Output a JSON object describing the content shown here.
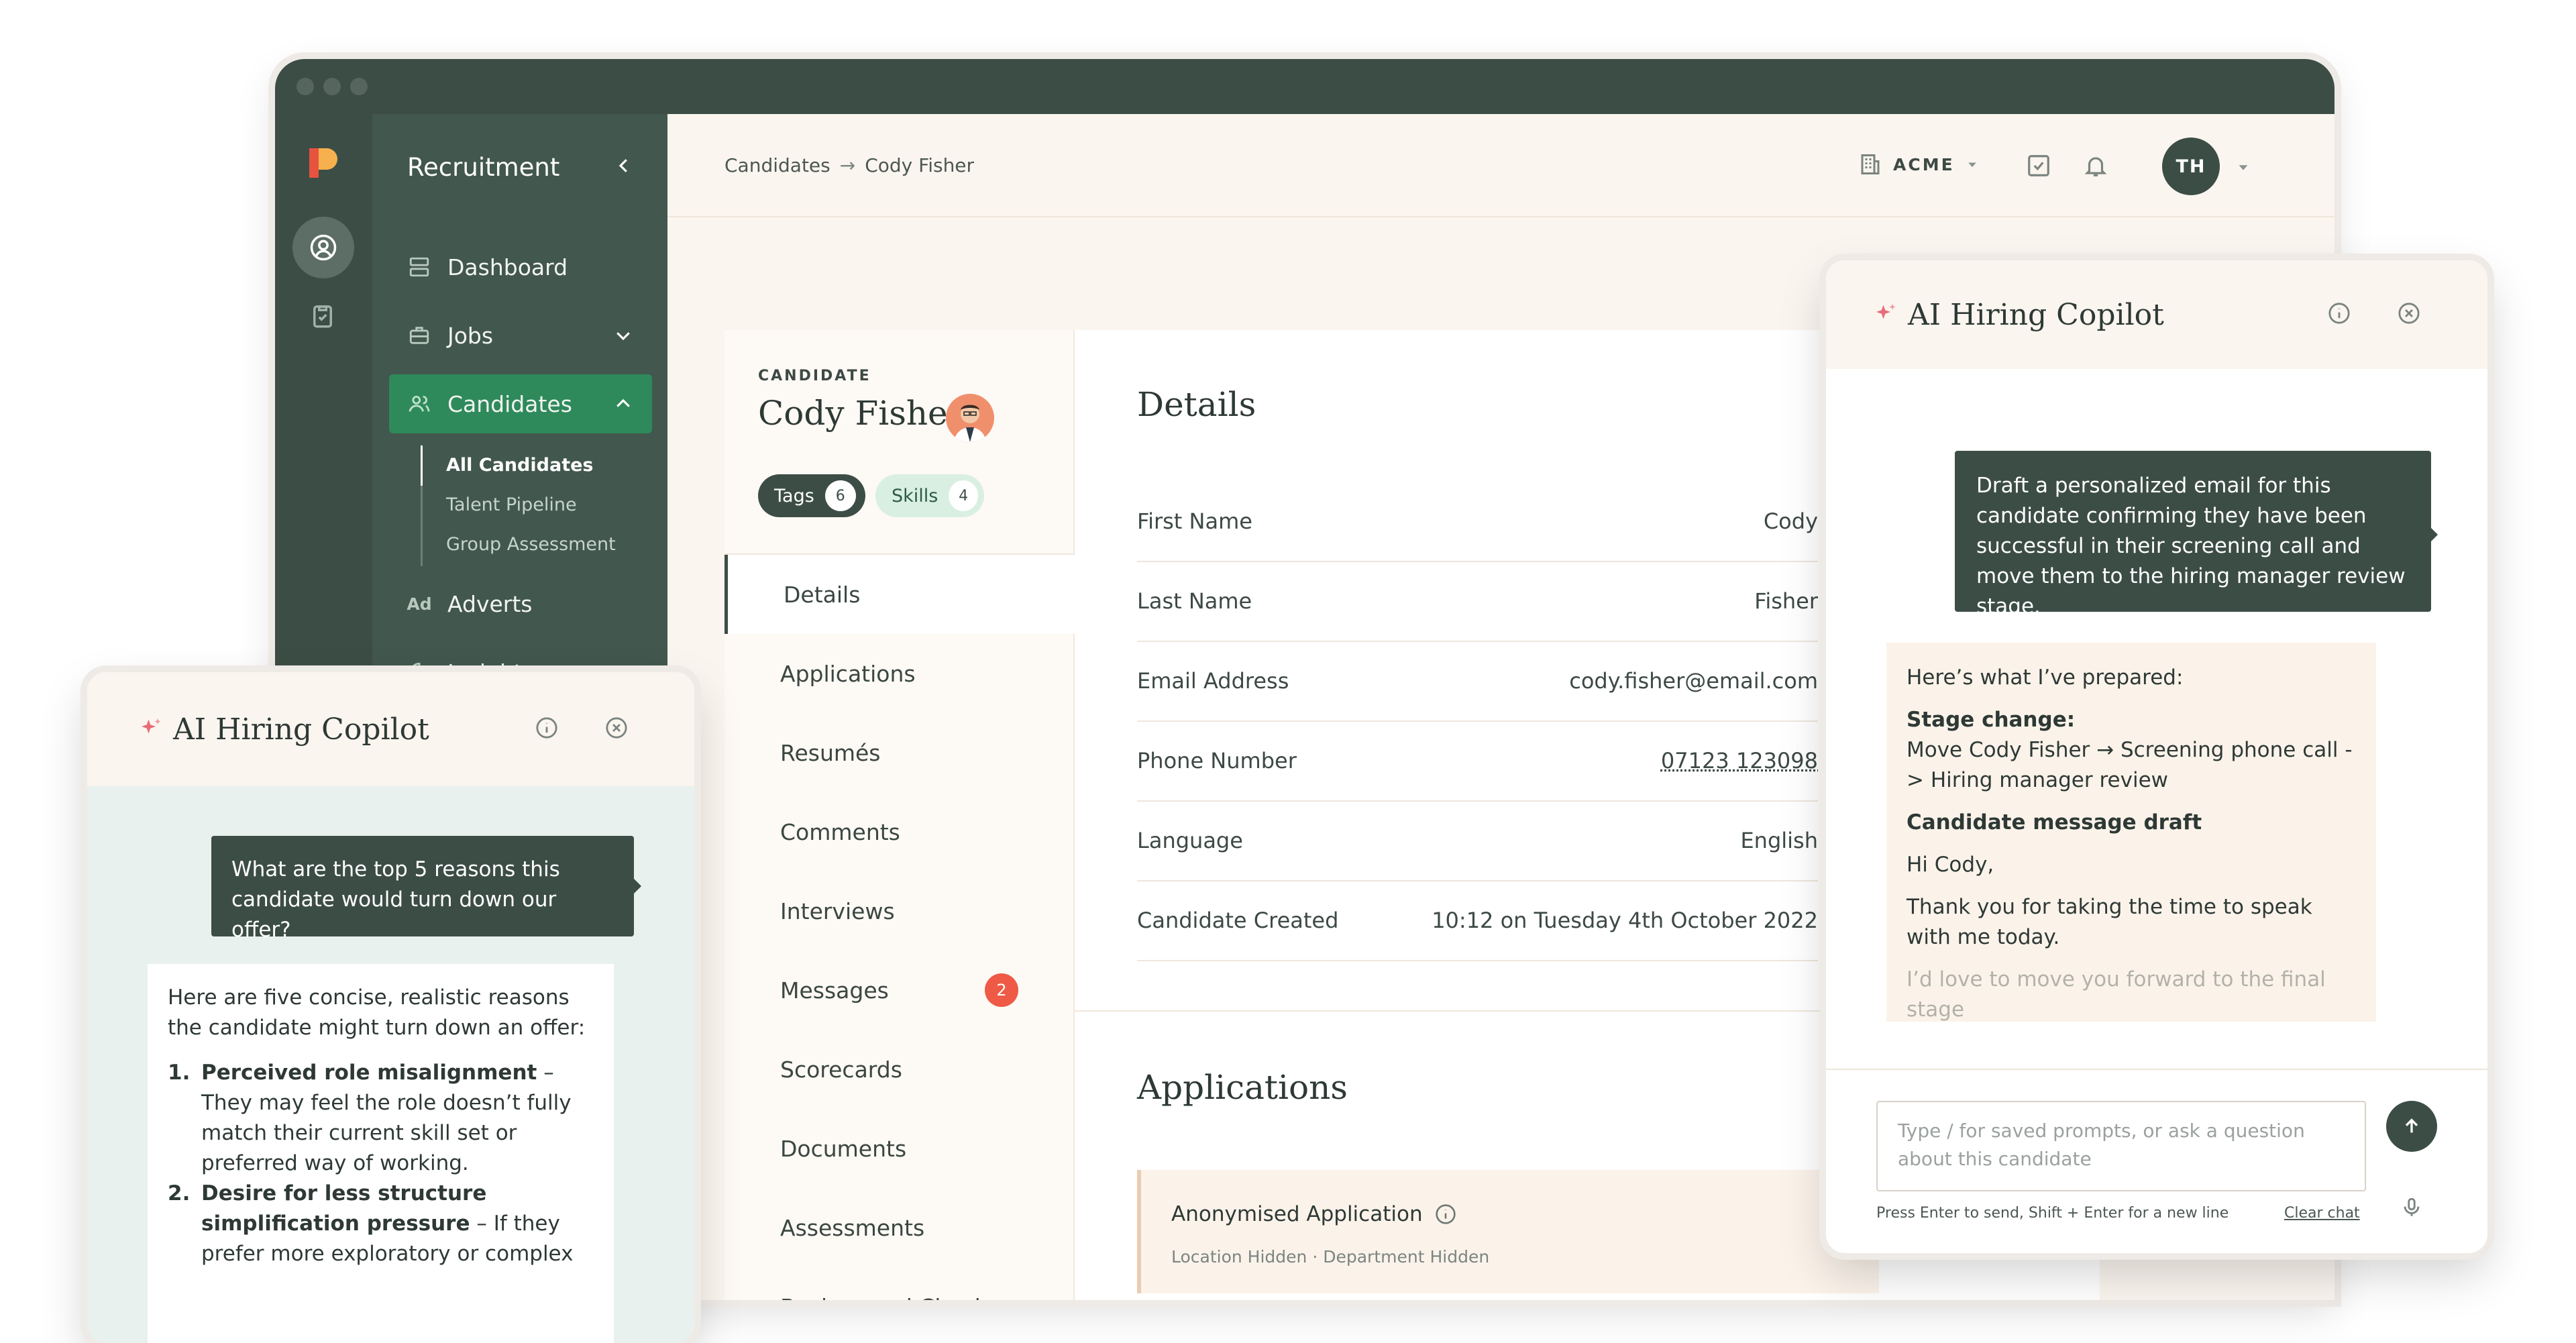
{
  "app": {
    "section_title": "Recruitment",
    "nav": [
      {
        "label": "Dashboard",
        "icon": "dashboard-icon"
      },
      {
        "label": "Jobs",
        "icon": "briefcase-icon"
      },
      {
        "label": "Candidates",
        "icon": "users-icon"
      },
      {
        "label": "Adverts",
        "icon": "ad-icon"
      },
      {
        "label": "Insights",
        "icon": "chart-icon"
      }
    ],
    "ad_badge": "Ad",
    "candidates_sub": [
      "All Candidates",
      "Talent Pipeline",
      "Group Assessment"
    ]
  },
  "topbar": {
    "breadcrumb_root": "Candidates",
    "breadcrumb_arrow": "→",
    "breadcrumb_current": "Cody Fisher",
    "org": "ACME",
    "avatar_initials": "TH"
  },
  "candidate": {
    "eyebrow": "CANDIDATE",
    "name": "Cody Fisher",
    "tags_label": "Tags",
    "tags_count": "6",
    "skills_label": "Skills",
    "skills_count": "4",
    "tabs": [
      "Details",
      "Applications",
      "Resumés",
      "Comments",
      "Interviews",
      "Messages",
      "Scorecards",
      "Documents",
      "Assessments",
      "Background Checks"
    ],
    "messages_badge": "2"
  },
  "details": {
    "title": "Details",
    "rows": [
      {
        "k": "First Name",
        "v": "Cody"
      },
      {
        "k": "Last Name",
        "v": "Fisher"
      },
      {
        "k": "Email Address",
        "v": "cody.fisher@email.com"
      },
      {
        "k": "Phone Number",
        "v": "07123 123098"
      },
      {
        "k": "Language",
        "v": "English"
      },
      {
        "k": "Candidate Created",
        "v": "10:12 on Tuesday 4th October 2022"
      }
    ]
  },
  "applications": {
    "title": "Applications",
    "item_title": "Anonymised Application",
    "item_meta": "Location Hidden · Department Hidden"
  },
  "copilot_right": {
    "title": "AI Hiring Copilot",
    "user_msg": "Draft a personalized email for this candidate confirming they have been successful in their screening call  and move them to the hiring manager review stage.",
    "ai_intro": "Here’s what I’ve prepared:",
    "stage_heading": "Stage change:",
    "stage_text": "Move Cody Fisher → Screening phone call -> Hiring manager review",
    "draft_heading": "Candidate message draft",
    "greeting": "Hi Cody,",
    "body1": "Thank you for taking the time to speak with me today.",
    "body2": "I’d love to move you forward to the final stage",
    "input_placeholder": "Type / for saved prompts, or ask a question about this candidate",
    "hint": "Press Enter to send, Shift + Enter for a new line",
    "clear": "Clear chat"
  },
  "copilot_left": {
    "title": "AI Hiring Copilot",
    "user_msg": "What are the top 5 reasons this candidate would turn down our offer?",
    "ai_intro": "Here are five concise, realistic reasons the candidate might turn down an offer:",
    "item1_num": "1.",
    "item1_bold": "Perceived role misalignment",
    "item1_text": " – They may feel the role doesn’t fully match their current skill set or preferred way of working.",
    "item2_num": "2.",
    "item2_bold": "Desire for less structure simplification pressure",
    "item2_text": " – If they prefer more exploratory or complex"
  }
}
